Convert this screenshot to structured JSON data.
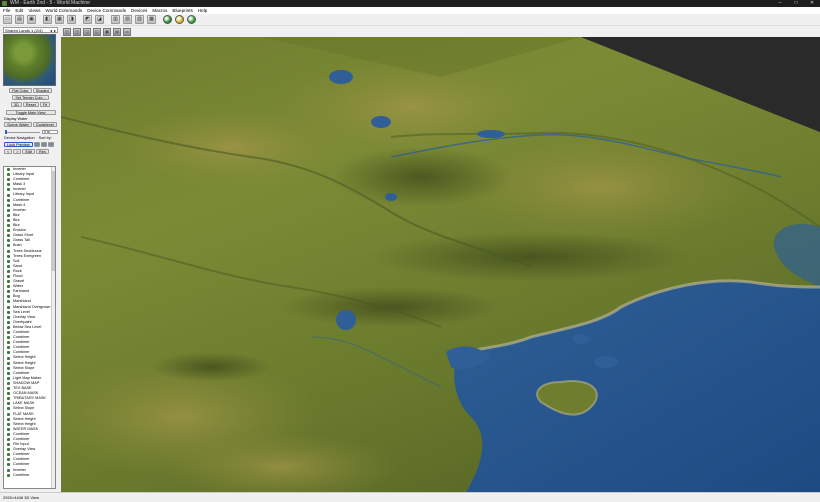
{
  "window": {
    "title": "WM - Earth 2nd - 5 - World Machine",
    "controls": {
      "minimize": "–",
      "maximize": "□",
      "close": "✕"
    }
  },
  "menu": [
    "File",
    "Edit",
    "Views",
    "World Commands",
    "Device Commands",
    "Devices",
    "Macros",
    "Blueprints",
    "Help"
  ],
  "toolbar": {
    "buttons": [
      {
        "icon": "new-world-icon",
        "glyph": "▭"
      },
      {
        "icon": "open-icon",
        "glyph": "▤"
      },
      {
        "icon": "save-icon",
        "glyph": "▣"
      },
      {
        "icon": "device-icon",
        "glyph": "◧"
      },
      {
        "icon": "build-icon",
        "glyph": "▦"
      },
      {
        "icon": "layout-icon",
        "glyph": "◨"
      },
      {
        "icon": "chart-icon",
        "glyph": "◩"
      },
      {
        "icon": "explorer-icon",
        "glyph": "◪"
      },
      {
        "icon": "settings-icon",
        "glyph": "▥"
      },
      {
        "icon": "view-icon",
        "glyph": "▧"
      },
      {
        "icon": "terrain-icon",
        "glyph": "▨"
      },
      {
        "icon": "render-icon",
        "glyph": "▩"
      },
      {
        "icon": "green-light-icon",
        "color": "#1f8f1f"
      },
      {
        "icon": "yellow-light-icon",
        "color": "#d8b41a"
      },
      {
        "icon": "green-build-icon",
        "color": "#2c9d2c"
      }
    ]
  },
  "view_toolbar": [
    {
      "icon": "perspective-icon",
      "glyph": "◰"
    },
    {
      "icon": "camera-icon",
      "glyph": "◳"
    },
    {
      "icon": "light-icon",
      "glyph": "◲"
    },
    {
      "icon": "water-icon",
      "glyph": "◱"
    },
    {
      "icon": "grid-icon",
      "glyph": "▦"
    },
    {
      "icon": "wireframe-icon",
      "glyph": "▤"
    },
    {
      "icon": "reset-view-icon",
      "glyph": "▭"
    }
  ],
  "preview": {
    "header": "Shared Lands 1 (2/4)",
    "buttons_row1": [
      "Flat Color",
      "Shaded"
    ],
    "button_set_terrain": "Set Terrain Colo...",
    "buttons_row2": [
      "3D",
      "Reset",
      "Fit"
    ],
    "toggle_button": "Toggle Main View",
    "display_water_label": "Display Water",
    "buttons_row3": [
      "Scene Water",
      "Guidelevel"
    ],
    "elevation_value": "0 m"
  },
  "device_nav": {
    "label_nav": "Device Navigation",
    "label_sort": "Sort by:",
    "lock_button": "Lock Preview",
    "small_buttons": [
      "<",
      ">",
      "Edit",
      "Res"
    ]
  },
  "tree_items": [
    {
      "label": "Inverter",
      "color": "#3a7a3a"
    },
    {
      "label": "Library Input",
      "color": "#3a7a3a"
    },
    {
      "label": "Combiner",
      "color": "#3a7a3a"
    },
    {
      "label": "Mask 3",
      "color": "#3a7a3a"
    },
    {
      "label": "Inverter",
      "color": "#3a7a3a"
    },
    {
      "label": "Library Input",
      "color": "#3a7a3a"
    },
    {
      "label": "Combiner",
      "color": "#3a7a3a"
    },
    {
      "label": "Mask 4",
      "color": "#3a7a3a"
    },
    {
      "label": "Inverter",
      "color": "#3a7a3a"
    },
    {
      "label": "Blur",
      "color": "#3a7a3a"
    },
    {
      "label": "Blur",
      "color": "#3a7a3a"
    },
    {
      "label": "Blur",
      "color": "#3a7a3a"
    },
    {
      "label": "Erosion",
      "color": "#3a7a3a"
    },
    {
      "label": "Grass Short",
      "color": "#3a7a3a"
    },
    {
      "label": "Grass Tall",
      "color": "#3a7a3a"
    },
    {
      "label": "Bush",
      "color": "#3a7a3a"
    },
    {
      "label": "Trees Deciduous",
      "color": "#3a7a3a"
    },
    {
      "label": "Trees Evergreen",
      "color": "#3a7a3a"
    },
    {
      "label": "Soil",
      "color": "#3a7a3a"
    },
    {
      "label": "Sand",
      "color": "#3a7a3a"
    },
    {
      "label": "Rock",
      "color": "#3a7a3a"
    },
    {
      "label": "Flood",
      "color": "#3a7a3a"
    },
    {
      "label": "Gravel",
      "color": "#3a7a3a"
    },
    {
      "label": "Water",
      "color": "#3a7a3a"
    },
    {
      "label": "Farmland",
      "color": "#3a7a3a"
    },
    {
      "label": "Bog",
      "color": "#3a7a3a"
    },
    {
      "label": "Marshland",
      "color": "#3a7a3a"
    },
    {
      "label": "Marshland Overgrown",
      "color": "#3a7a3a"
    },
    {
      "label": "Sea Level",
      "color": "#3a7a3a"
    },
    {
      "label": "Overlay View",
      "color": "#3a7a3a"
    },
    {
      "label": "Overhpaint",
      "color": "#3a7a3a"
    },
    {
      "label": "Below Sea Level",
      "color": "#3a7a3a"
    },
    {
      "label": "Combiner",
      "color": "#3a7a3a"
    },
    {
      "label": "Combiner",
      "color": "#3a7a3a"
    },
    {
      "label": "Combiner",
      "color": "#3a7a3a"
    },
    {
      "label": "Combiner",
      "color": "#3a7a3a"
    },
    {
      "label": "Combiner",
      "color": "#3a7a3a"
    },
    {
      "label": "Select Height",
      "color": "#3a7a3a"
    },
    {
      "label": "Select Height",
      "color": "#3a7a3a"
    },
    {
      "label": "Select Slope",
      "color": "#3a7a3a"
    },
    {
      "label": "Combiner",
      "color": "#3a7a3a"
    },
    {
      "label": "Light Map Maker",
      "color": "#3a7a3a"
    },
    {
      "label": "SHADOW MAP",
      "color": "#3a7a3a"
    },
    {
      "label": "TEX BASE",
      "color": "#3a7a3a"
    },
    {
      "label": "OCEAN MASK",
      "color": "#3a7a3a"
    },
    {
      "label": "TRIBUTARY MASK",
      "color": "#3a7a3a"
    },
    {
      "label": "LAKE MASK",
      "color": "#3a7a3a"
    },
    {
      "label": "Select Slope",
      "color": "#3a7a3a"
    },
    {
      "label": "FLAT MASK",
      "color": "#3a7a3a"
    },
    {
      "label": "Select Height",
      "color": "#3a7a3a"
    },
    {
      "label": "Select Height",
      "color": "#3a7a3a"
    },
    {
      "label": "WATER MASK",
      "color": "#3a7a3a"
    },
    {
      "label": "Combiner",
      "color": "#3a7a3a"
    },
    {
      "label": "Combiner",
      "color": "#3a7a3a"
    },
    {
      "label": "File Input",
      "color": "#3a7a3a"
    },
    {
      "label": "Overlay View",
      "color": "#3a7a3a"
    },
    {
      "label": "Combiner",
      "color": "#3a7a3a"
    },
    {
      "label": "Combiner",
      "color": "#3a7a3a"
    },
    {
      "label": "Combiner",
      "color": "#3a7a3a"
    },
    {
      "label": "Inverter",
      "color": "#3a7a3a"
    },
    {
      "label": "Combiner",
      "color": "#3a7a3a"
    }
  ],
  "statusbar": {
    "text": "2920×4446 3D View"
  }
}
